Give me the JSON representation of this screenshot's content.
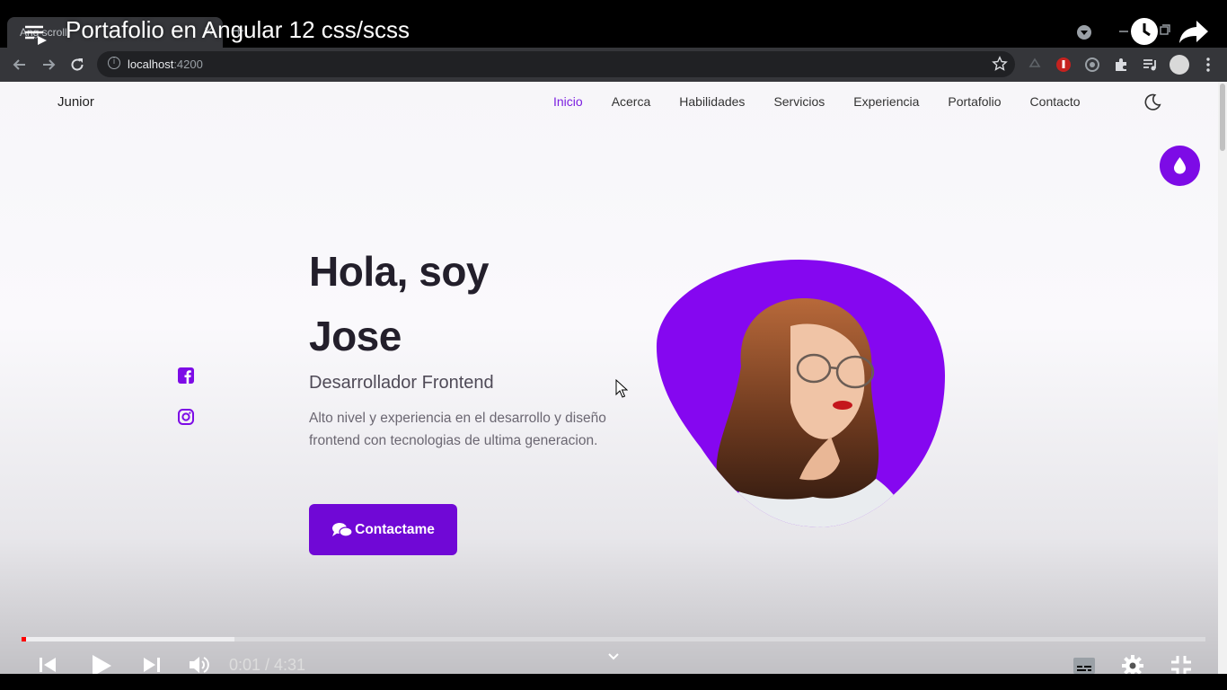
{
  "video": {
    "title": "Portafolio en Angular 12 css/scss",
    "time": "0:01 / 4:31",
    "played": 0.004,
    "buffered": 0.18
  },
  "browser": {
    "tab_title": "Ang scroll",
    "tab_close": "×",
    "new_tab": "+",
    "url_host": "localhost",
    "url_port": ":4200"
  },
  "site": {
    "logo": "Junior",
    "nav": {
      "inicio": "Inicio",
      "acerca": "Acerca",
      "habilidades": "Habilidades",
      "servicios": "Servicios",
      "experiencia": "Experiencia",
      "portafolio": "Portafolio",
      "contacto": "Contacto"
    },
    "hero": {
      "line1": "Hola, soy",
      "line2": "Jose",
      "subtitle": "Desarrollador Frontend",
      "description": "Alto nivel y experiencia en el desarrollo y diseño frontend con tecnologias de ultima generacion.",
      "cta": "Contactame"
    },
    "colors": {
      "accent": "#7d0be6",
      "button": "#7008d6",
      "blob": "#8507f0"
    }
  },
  "icons": [
    "facebook-icon",
    "instagram-icon",
    "moon-icon",
    "droplet-icon",
    "chat-icon",
    "play-icon",
    "volume-icon",
    "settings-icon",
    "subtitles-icon",
    "fullscreen-exit-icon",
    "share-icon",
    "clock-icon"
  ]
}
